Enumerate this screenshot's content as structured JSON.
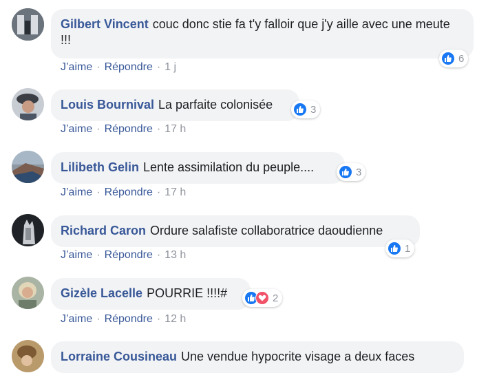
{
  "labels": {
    "like": "J’aime",
    "reply": "Répondre",
    "sep": "·"
  },
  "comments": [
    {
      "author": "Gilbert Vincent",
      "text": "couc donc stie fa t'y falloir que j'y aille avec une meute !!!",
      "time": "1 j",
      "reactions": 6,
      "reaction_types": [
        "like"
      ],
      "avatar_icon": "avatar-icon"
    },
    {
      "author": "Louis Bournival",
      "text": "La parfaite colonisée",
      "time": "17 h",
      "reactions": 3,
      "reaction_types": [
        "like"
      ],
      "avatar_icon": "avatar-icon"
    },
    {
      "author": "Lilibeth Gelin",
      "text": "Lente assimilation du peuple....",
      "time": "17 h",
      "reactions": 3,
      "reaction_types": [
        "like"
      ],
      "avatar_icon": "avatar-icon"
    },
    {
      "author": "Richard Caron",
      "text": "Ordure salafiste collaboratrice daoudienne",
      "time": "13 h",
      "reactions": 1,
      "reaction_types": [
        "like"
      ],
      "avatar_icon": "avatar-icon"
    },
    {
      "author": "Gizèle Lacelle",
      "text": "POURRIE !!!!#",
      "time": "12 h",
      "reactions": 2,
      "reaction_types": [
        "like",
        "love"
      ],
      "avatar_icon": "avatar-icon"
    },
    {
      "author": "Lorraine Cousineau",
      "text": "Une vendue hypocrite visage a deux faces",
      "avatar_icon": "avatar-icon"
    }
  ],
  "colors": {
    "author": "#385898",
    "bubble": "#f2f3f5",
    "like": "#1877f2",
    "love": "#f25268",
    "meta": "#90949c"
  }
}
